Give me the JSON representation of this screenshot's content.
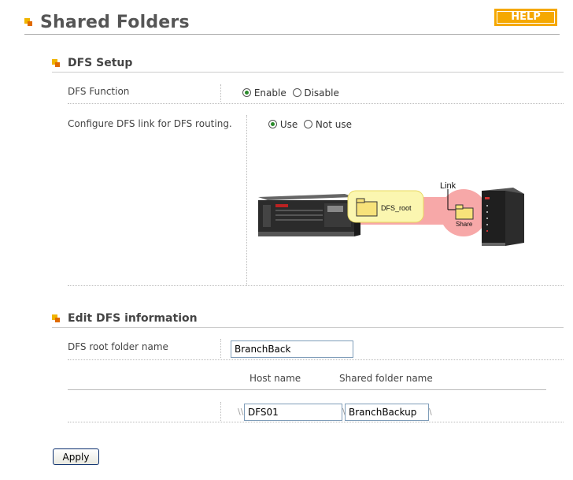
{
  "page": {
    "title": "Shared Folders",
    "help_label": "HELP"
  },
  "dfs_setup": {
    "title": "DFS Setup",
    "function_label": "DFS Function",
    "function_options": {
      "enable": "Enable",
      "disable": "Disable",
      "selected": "Enable"
    },
    "link_label": "Configure DFS link for DFS routing.",
    "link_options": {
      "use": "Use",
      "not_use": "Not use",
      "selected": "Use"
    },
    "diagram": {
      "root_folder": "DFS_root",
      "link": "Link",
      "share": "Share"
    }
  },
  "edit_dfs": {
    "title": "Edit DFS information",
    "root_folder_label": "DFS root folder name",
    "root_folder_value": "BranchBack",
    "host_header": "Host name",
    "shared_header": "Shared folder name",
    "path_prefix": "\\\\",
    "path_separator": "\\",
    "path_suffix": "\\",
    "host_value": "DFS01",
    "shared_value": "BranchBackup"
  },
  "apply_label": "Apply",
  "colors": {
    "accent": "#f5a800",
    "bullet_dark": "#e06a00",
    "radio_on": "#2a8a2a"
  }
}
